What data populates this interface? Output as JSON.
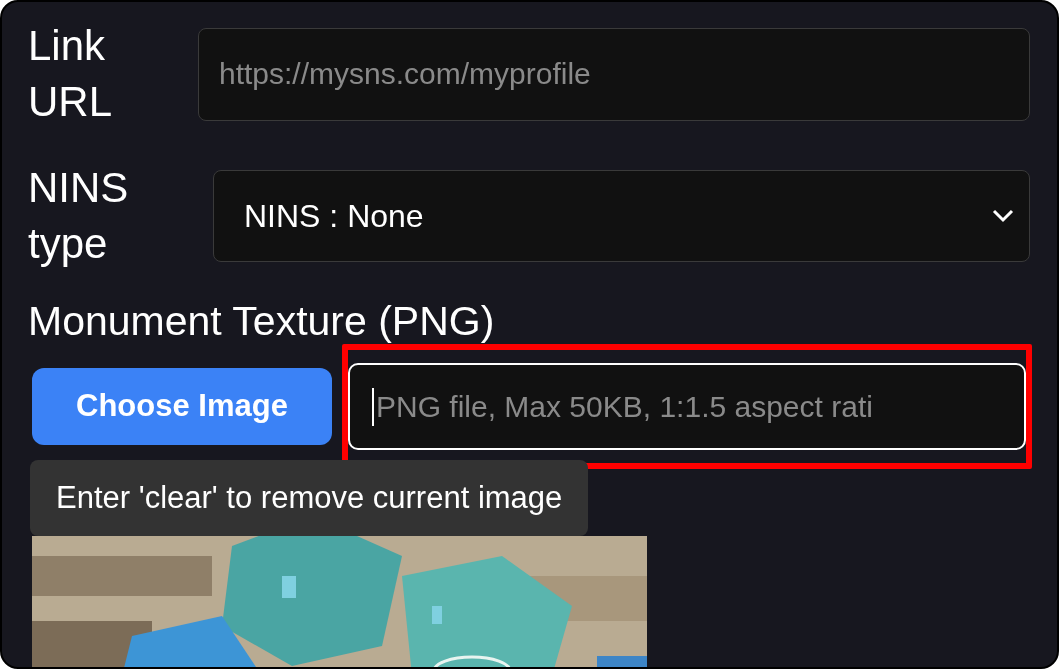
{
  "fields": [
    {
      "label": "Link URL",
      "kind": "text",
      "placeholder": "https://mysns.com/myprofile"
    },
    {
      "label": "NINS type",
      "kind": "select",
      "value": "NINS : None"
    }
  ],
  "texture": {
    "label": "Monument Texture (PNG)",
    "button": "Choose Image",
    "placeholder": "PNG file, Max 50KB, 1:1.5 aspect rati",
    "focused": true,
    "highlighted": true,
    "tooltip": "Enter 'clear' to remove current image"
  }
}
